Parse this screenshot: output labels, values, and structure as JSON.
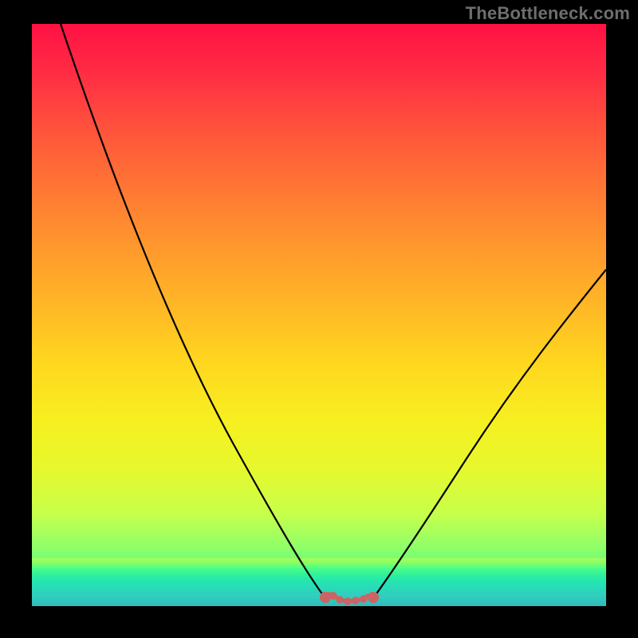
{
  "watermark": "TheBottleneck.com",
  "chart_data": {
    "type": "line",
    "title": "",
    "xlabel": "",
    "ylabel": "",
    "xlim": [
      0,
      100
    ],
    "ylim": [
      0,
      100
    ],
    "grid": false,
    "series": [
      {
        "name": "left-branch",
        "x": [
          5,
          15,
          25,
          35,
          42,
          48,
          52
        ],
        "y": [
          100,
          79,
          58,
          38,
          22,
          8,
          1
        ]
      },
      {
        "name": "right-branch",
        "x": [
          58,
          62,
          70,
          80,
          90,
          100
        ],
        "y": [
          1,
          6,
          17,
          31,
          45,
          58
        ]
      },
      {
        "name": "marker-band",
        "x": [
          51,
          52,
          53,
          55,
          57,
          58,
          59
        ],
        "y": [
          0.5,
          1.2,
          0.6,
          0.4,
          0.6,
          1.2,
          0.5
        ]
      }
    ],
    "marker_color": "#d46a6a",
    "line_color": "#000000",
    "gradient_stops": [
      {
        "pos": 0,
        "color": "#ff1144"
      },
      {
        "pos": 0.5,
        "color": "#ffd61f"
      },
      {
        "pos": 0.95,
        "color": "#4dff82"
      },
      {
        "pos": 1.0,
        "color": "#2ae0b4"
      }
    ]
  }
}
